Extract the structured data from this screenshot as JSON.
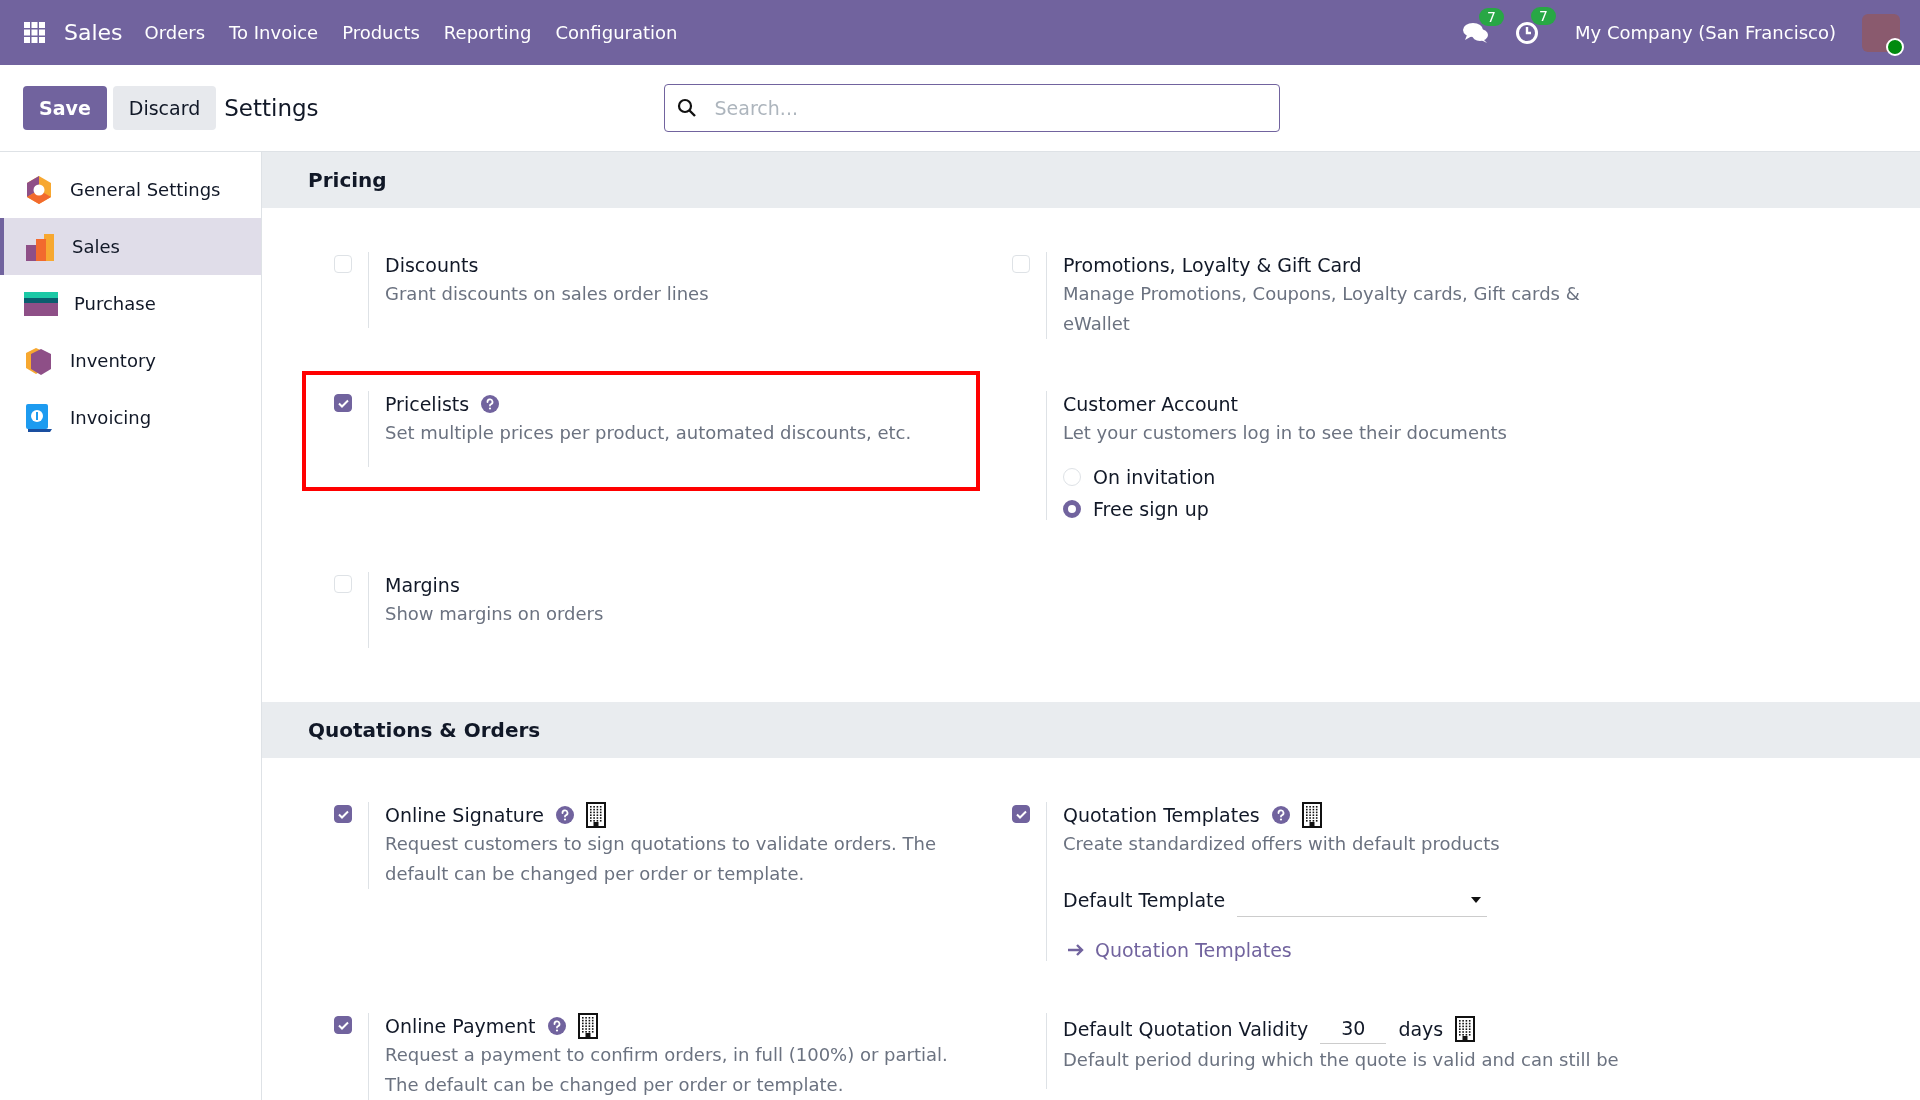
{
  "navbar": {
    "app": "Sales",
    "menu": [
      "Orders",
      "To Invoice",
      "Products",
      "Reporting",
      "Configuration"
    ],
    "messages_badge": "7",
    "activities_badge": "7",
    "company": "My Company (San Francisco)"
  },
  "toolbar": {
    "save": "Save",
    "discard": "Discard",
    "title": "Settings",
    "search": {
      "placeholder": "Search..."
    }
  },
  "sidebar": {
    "items": [
      {
        "label": "General Settings",
        "selected": false
      },
      {
        "label": "Sales",
        "selected": true
      },
      {
        "label": "Purchase",
        "selected": false
      },
      {
        "label": "Inventory",
        "selected": false
      },
      {
        "label": "Invoicing",
        "selected": false
      }
    ]
  },
  "sections": [
    {
      "title": "Pricing",
      "settings": [
        {
          "kind": "checkbox",
          "title": "Discounts",
          "checked": false,
          "help": false,
          "company": false,
          "highlighted": false,
          "description": "Grant discounts on sales order lines"
        },
        {
          "kind": "checkbox",
          "title": "Promotions, Loyalty & Gift Card",
          "checked": false,
          "help": false,
          "company": false,
          "highlighted": false,
          "description": "Manage Promotions, Coupons, Loyalty cards, Gift cards & eWallet"
        },
        {
          "kind": "checkbox",
          "title": "Pricelists",
          "checked": true,
          "help": true,
          "company": false,
          "highlighted": true,
          "description": "Set multiple prices per product, automated discounts, etc."
        },
        {
          "kind": "plain",
          "title": "Customer Account",
          "help": false,
          "company": false,
          "highlighted": false,
          "description": "Let your customers log in to see their documents",
          "radios": [
            {
              "label": "On invitation",
              "selected": false
            },
            {
              "label": "Free sign up",
              "selected": true
            }
          ]
        },
        {
          "kind": "checkbox",
          "title": "Margins",
          "checked": false,
          "help": false,
          "company": false,
          "highlighted": false,
          "description": "Show margins on orders"
        }
      ]
    },
    {
      "title": "Quotations & Orders",
      "settings": [
        {
          "kind": "checkbox",
          "title": "Online Signature",
          "checked": true,
          "help": true,
          "company": true,
          "highlighted": false,
          "description": "Request customers to sign quotations to validate orders. The default can be changed per order or template."
        },
        {
          "kind": "checkbox",
          "title": "Quotation Templates",
          "checked": true,
          "help": true,
          "company": true,
          "highlighted": false,
          "description": "Create standardized offers with default products",
          "select": {
            "label": "Default Template"
          },
          "link": "Quotation Templates"
        },
        {
          "kind": "checkbox",
          "title": "Online Payment",
          "checked": true,
          "help": true,
          "company": true,
          "highlighted": false,
          "description": "Request a payment to confirm orders, in full (100%) or partial. The default can be changed per order or template."
        },
        {
          "kind": "number",
          "title": "Default Quotation Validity",
          "value": "30",
          "unit": "days",
          "help": false,
          "company": true,
          "highlighted": false,
          "description": "Default period during which the quote is valid and can still be"
        }
      ]
    }
  ]
}
